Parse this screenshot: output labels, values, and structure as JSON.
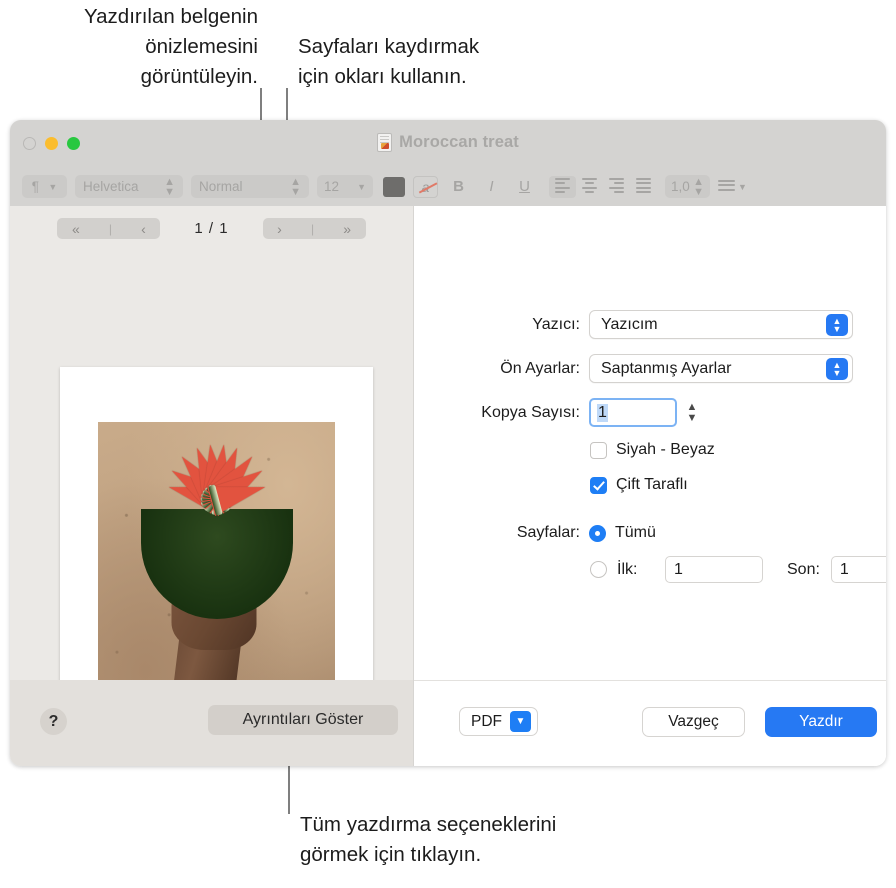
{
  "callouts": {
    "preview": "Yazdırılan belgenin\nönizlemesini\ngörüntüleyin.",
    "arrows": "Sayfaları kaydırmak\niçin okları kullanın.",
    "details": "Tüm yazdırma seçeneklerini\ngörmek için tıklayın."
  },
  "window": {
    "title": "Moroccan treat",
    "doc_icon": "document-icon",
    "traffic_lights": [
      "close",
      "minimize",
      "zoom"
    ]
  },
  "toolbar": {
    "paragraph_style_icon": "paragraph-icon",
    "font_family": "Helvetica",
    "font_style": "Normal",
    "font_size": "12",
    "color_swatch": "#6e6d6b",
    "highlight_icon": "strikethrough-a-icon",
    "bold": "B",
    "italic": "I",
    "underline": "U",
    "line_spacing": "1,0",
    "list_icon": "bulleted-list-icon"
  },
  "preview": {
    "first_label": "«",
    "prev_label": "‹",
    "next_label": "›",
    "last_label": "»",
    "separator": "|",
    "page_count": "1 / 1",
    "photo_alt": "watermelon-carved-flower-held-in-hand"
  },
  "print_options": {
    "printer_label": "Yazıcı:",
    "printer_value": "Yazıcım",
    "presets_label": "Ön Ayarlar:",
    "presets_value": "Saptanmış Ayarlar",
    "copies_label": "Kopya Sayısı:",
    "copies_value": "1",
    "blackwhite_label": "Siyah - Beyaz",
    "blackwhite_checked": false,
    "duplex_label": "Çift Taraflı",
    "duplex_checked": true,
    "pages_label": "Sayfalar:",
    "pages_all_label": "Tümü",
    "pages_all_selected": true,
    "pages_from_label": "İlk:",
    "pages_from_value": "1",
    "pages_to_label": "Son:",
    "pages_to_value": "1"
  },
  "footer": {
    "help_label": "?",
    "show_details_label": "Ayrıntıları Göster",
    "pdf_label": "PDF",
    "cancel_label": "Vazgeç",
    "print_label": "Yazdır"
  },
  "colors": {
    "accent_blue": "#2679f3",
    "titlebar": "#d4d3d1",
    "left_pane": "#ebe9e6",
    "left_bottom": "#e3e0dc"
  }
}
